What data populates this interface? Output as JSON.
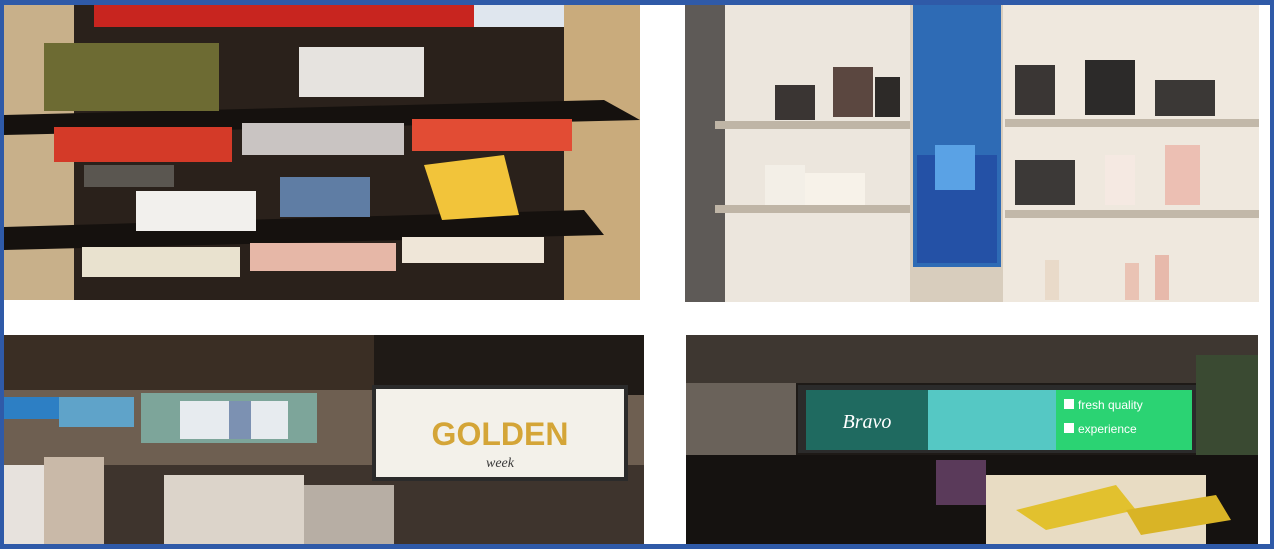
{
  "photos": [
    {
      "name": "shelf-display-screens"
    },
    {
      "name": "cosmetics-shelf-display"
    },
    {
      "name": "clothing-store-screens",
      "screen_text": {
        "main": "GOLDEN",
        "sub": "week"
      }
    },
    {
      "name": "wine-store-banner",
      "screen_text": {
        "brand": "Bravo",
        "line1": "fresh quality",
        "line2": "experience"
      }
    }
  ],
  "colors": {
    "frame": "#2f5aa8",
    "background": "#ffffff"
  }
}
